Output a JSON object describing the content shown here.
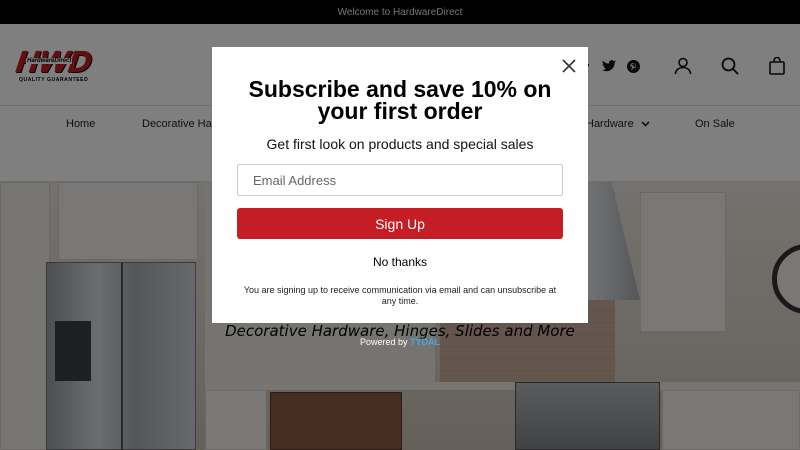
{
  "announcement": {
    "text": "Welcome to HardwareDirect"
  },
  "logo": {
    "main": "HWD",
    "overlay": "HardwareDirect",
    "tagline": "QUALITY GUARANTEED"
  },
  "header_icons": [
    "facebook-icon",
    "twitter-icon",
    "pinterest-icon",
    "account-icon",
    "search-icon",
    "cart-icon"
  ],
  "nav": {
    "items": [
      {
        "label": "Home"
      },
      {
        "label": "Decorative Ha"
      },
      {
        "label": "Hardware"
      },
      {
        "label": "On Sale"
      }
    ]
  },
  "hero": {
    "tagline": "Decorative Hardware, Hinges, Slides and More"
  },
  "modal": {
    "title": "Subscribe and save 10% on your first order",
    "subtitle": "Get first look on products and special sales",
    "email_placeholder": "Email Address",
    "signup_label": "Sign Up",
    "no_thanks_label": "No thanks",
    "disclaimer": "You are signing up to receive communication via email and can unsubscribe at any time."
  },
  "powered_by": {
    "prefix": "Powered by",
    "brand": "TYDAL"
  },
  "colors": {
    "brand_red": "#c41e24",
    "tydal_blue": "#4aa3df"
  }
}
